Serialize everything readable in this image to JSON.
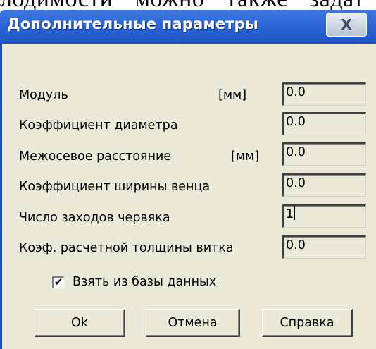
{
  "background_text": "лодимости можно также задат",
  "dialog": {
    "title": "Дополнительные параметры",
    "close_label": "X"
  },
  "fields": [
    {
      "label": "Модуль",
      "unit": "[мм]",
      "value": "0.0"
    },
    {
      "label": "Коэффициент диаметра",
      "unit": "",
      "value": "0.0"
    },
    {
      "label": "Межосевое расстояние",
      "unit": "[мм]",
      "value": "0.0"
    },
    {
      "label": "Коэффициент ширины венца",
      "unit": "",
      "value": "0.0"
    },
    {
      "label": "Число заходов червяка",
      "unit": "",
      "value": "1"
    },
    {
      "label": "Коэф. расчетной толщины витка",
      "unit": "",
      "value": "0.0"
    }
  ],
  "checkbox": {
    "label": "Взять из базы данных",
    "checked": true
  },
  "buttons": {
    "ok": "Ok",
    "cancel": "Отмена",
    "help": "Справка"
  }
}
